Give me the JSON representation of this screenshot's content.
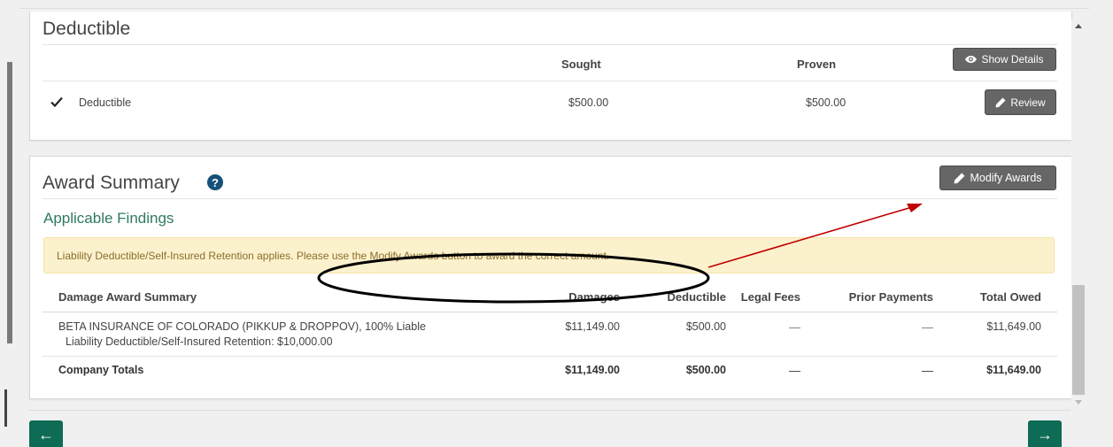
{
  "deductible_section": {
    "title": "Deductible",
    "columns": {
      "sought": "Sought",
      "proven": "Proven"
    },
    "show_details_label": "Show Details",
    "row": {
      "label": "Deductible",
      "sought": "$500.00",
      "proven": "$500.00",
      "review_label": "Review"
    }
  },
  "award_summary": {
    "title": "Award Summary",
    "help_glyph": "?",
    "modify_awards_label": "Modify Awards",
    "applicable_findings_title": "Applicable Findings",
    "alert_text": "Liability Deductible/Self-Insured Retention applies.  Please use the Modify Awards button to award the correct amount.",
    "table": {
      "headers": [
        "Damage Award Summary",
        "Damages",
        "Deductible",
        "Legal Fees",
        "Prior Payments",
        "Total Owed"
      ],
      "rows": [
        {
          "name": "BETA INSURANCE OF COLORADO (PIKKUP & DROPPOV), 100% Liable",
          "sub": "Liability Deductible/Self-Insured Retention: $10,000.00",
          "damages": "$11,149.00",
          "deductible": "$500.00",
          "legal_fees": "—",
          "prior_payments": "—",
          "total_owed": "$11,649.00"
        }
      ],
      "totals": {
        "label": "Company Totals",
        "damages": "$11,149.00",
        "deductible": "$500.00",
        "legal_fees": "—",
        "prior_payments": "—",
        "total_owed": "$11,649.00"
      }
    }
  },
  "navigation": {
    "prev_glyph": "←",
    "next_glyph": "→"
  },
  "colors": {
    "accent_green": "#0e6b55",
    "findings_green": "#2f7a62",
    "alert_bg": "#fcf1cd",
    "annotation_red": "#c00000"
  },
  "icons": {
    "show_details": "eye-icon",
    "review": "pencil-icon",
    "modify_awards": "pencil-icon",
    "checkmark": "check-icon",
    "help": "question-circle-icon"
  }
}
